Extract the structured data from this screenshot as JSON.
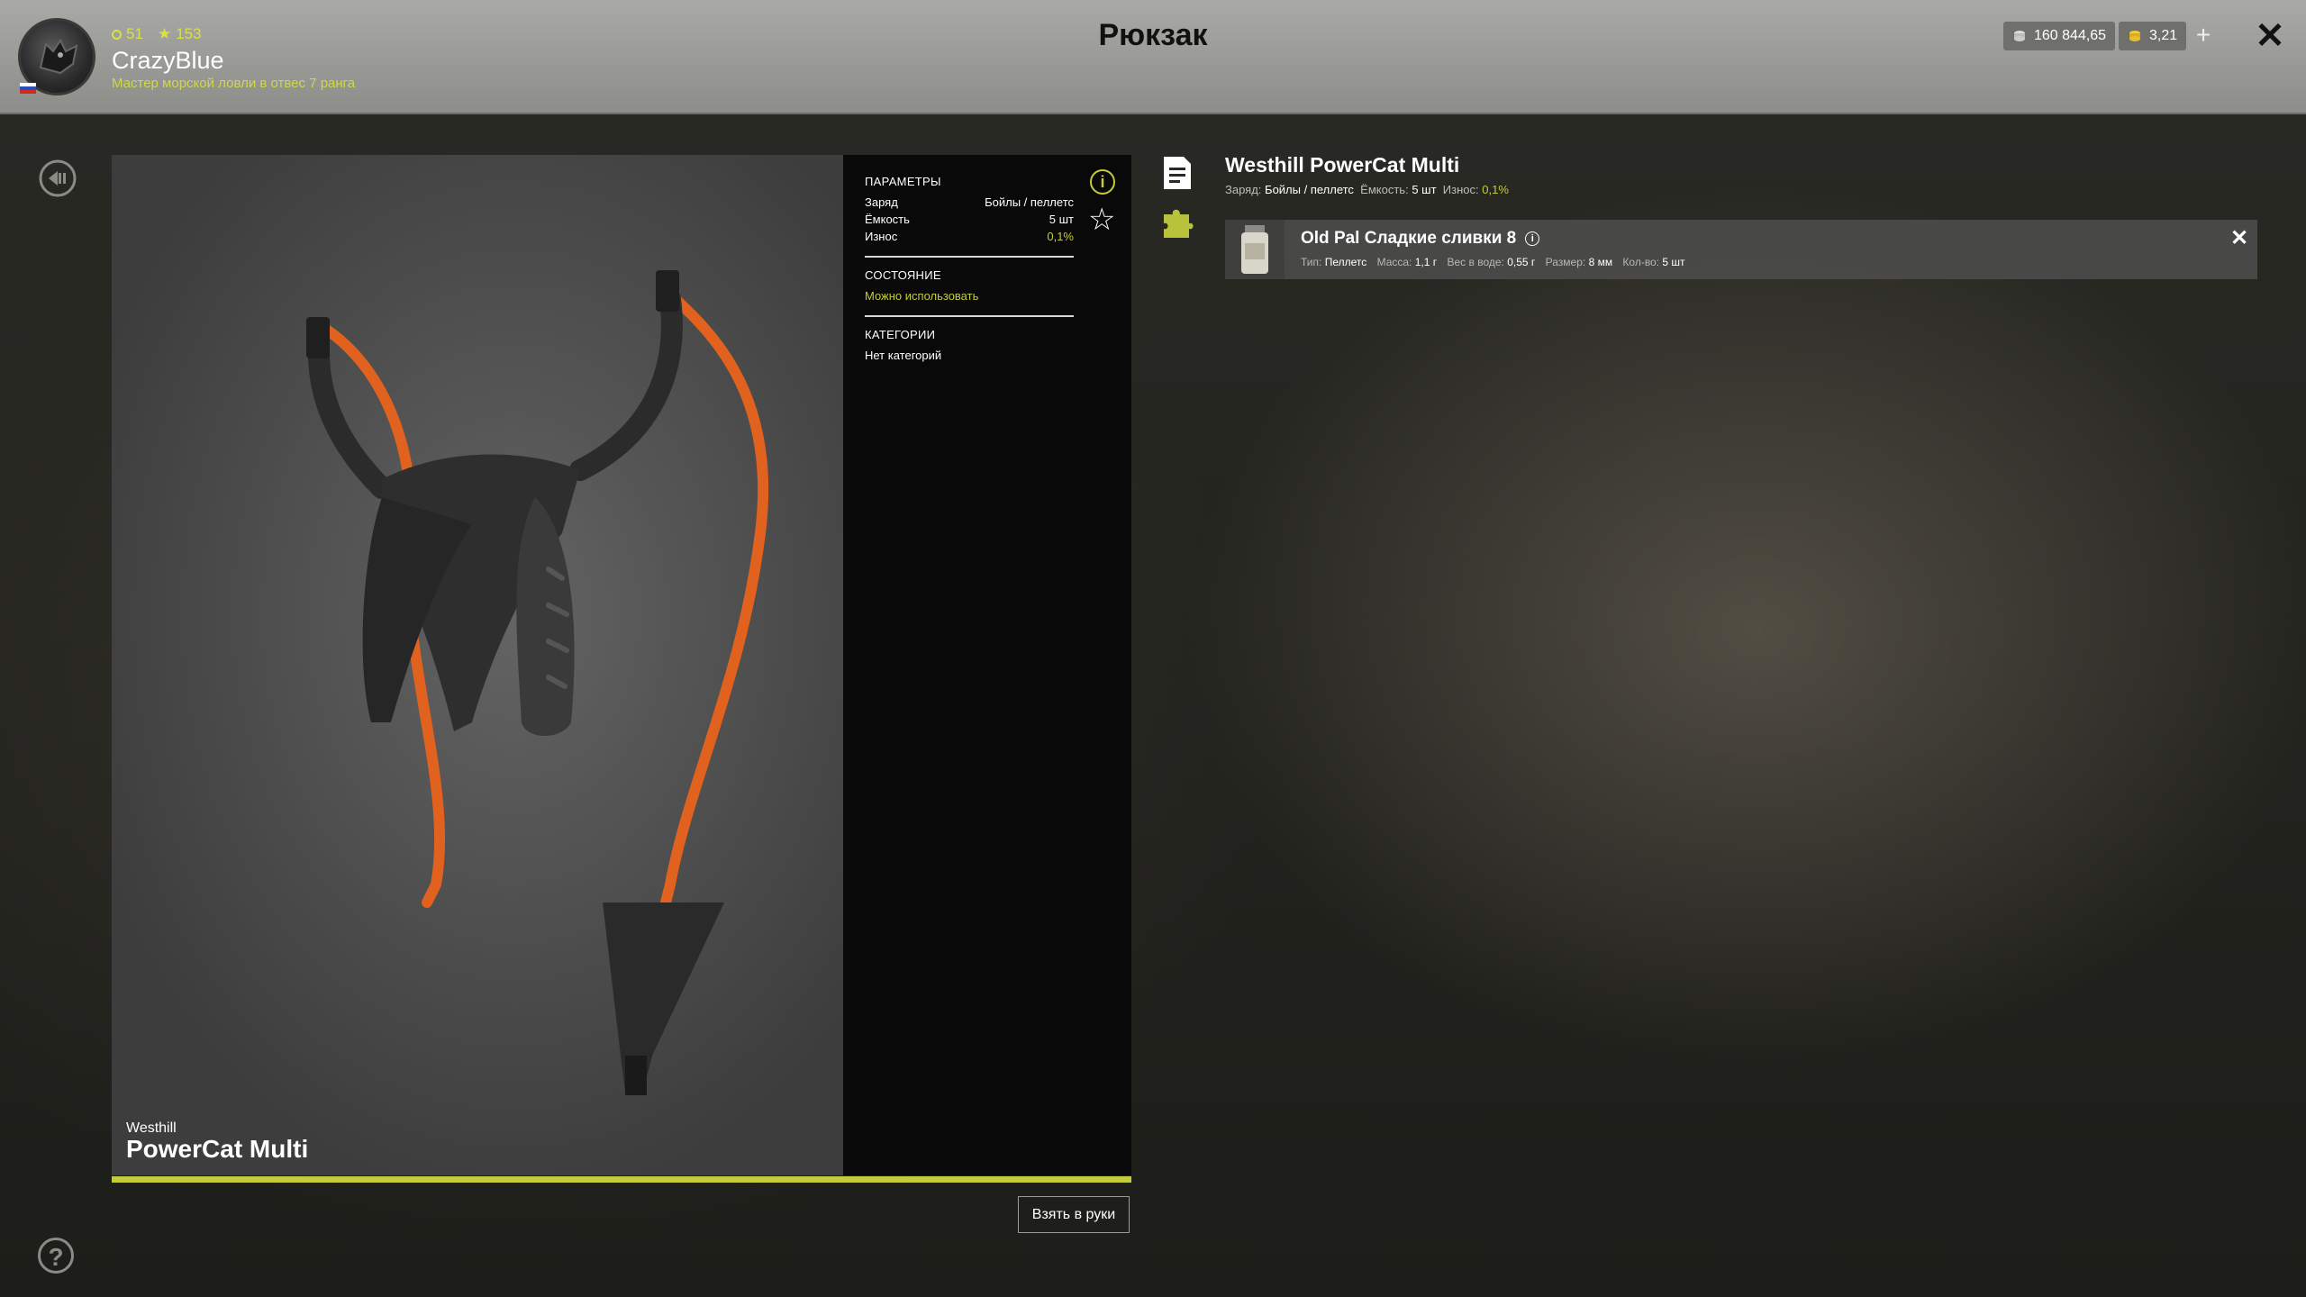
{
  "header": {
    "title": "Рюкзак",
    "profile": {
      "level": "51",
      "rank_points": "153",
      "username": "CrazyBlue",
      "rank_title": "Мастер морской ловли в отвес 7 ранга"
    },
    "silver": "160 844,65",
    "gold": "3,21",
    "plus_label": "+",
    "close_label": "✕"
  },
  "sidebar": {
    "help_label": "?"
  },
  "viewer": {
    "brand": "Westhill",
    "model": "PowerCat Multi"
  },
  "params": {
    "section1_title": "ПАРАМЕТРЫ",
    "rows": [
      {
        "label": "Заряд",
        "value": "Бойлы / пеллетс"
      },
      {
        "label": "Ёмкость",
        "value": "5 шт"
      },
      {
        "label": "Износ",
        "value": "0,1%"
      }
    ],
    "section2_title": "СОСТОЯНИЕ",
    "status": "Можно использовать",
    "section3_title": "КАТЕГОРИИ",
    "categories": "Нет категорий"
  },
  "actions": {
    "take_label": "Взять в руки"
  },
  "details": {
    "title": "Westhill PowerCat Multi",
    "charge_label": "Заряд:",
    "charge_value": "Бойлы / пеллетс",
    "capacity_label": "Ёмкость:",
    "capacity_value": "5 шт",
    "wear_label": "Износ:",
    "wear_value": "0,1%",
    "bait": {
      "name": "Old Pal Сладкие сливки 8",
      "type_label": "Тип:",
      "type_value": "Пеллетс",
      "mass_label": "Масса:",
      "mass_value": "1,1 г",
      "water_label": "Вес в воде:",
      "water_value": "0,55 г",
      "size_label": "Размер:",
      "size_value": "8 мм",
      "qty_label": "Кол-во:",
      "qty_value": "5 шт",
      "remove_label": "✕"
    }
  },
  "colors": {
    "accent": "#c3cc3c",
    "sling_band": "#e0621e",
    "topbar": "#9c9c98"
  },
  "icons": [
    "back-icon",
    "help-icon",
    "info-icon",
    "star-icon",
    "document-icon",
    "puzzle-icon",
    "silver-coin-icon",
    "gold-coin-icon"
  ]
}
